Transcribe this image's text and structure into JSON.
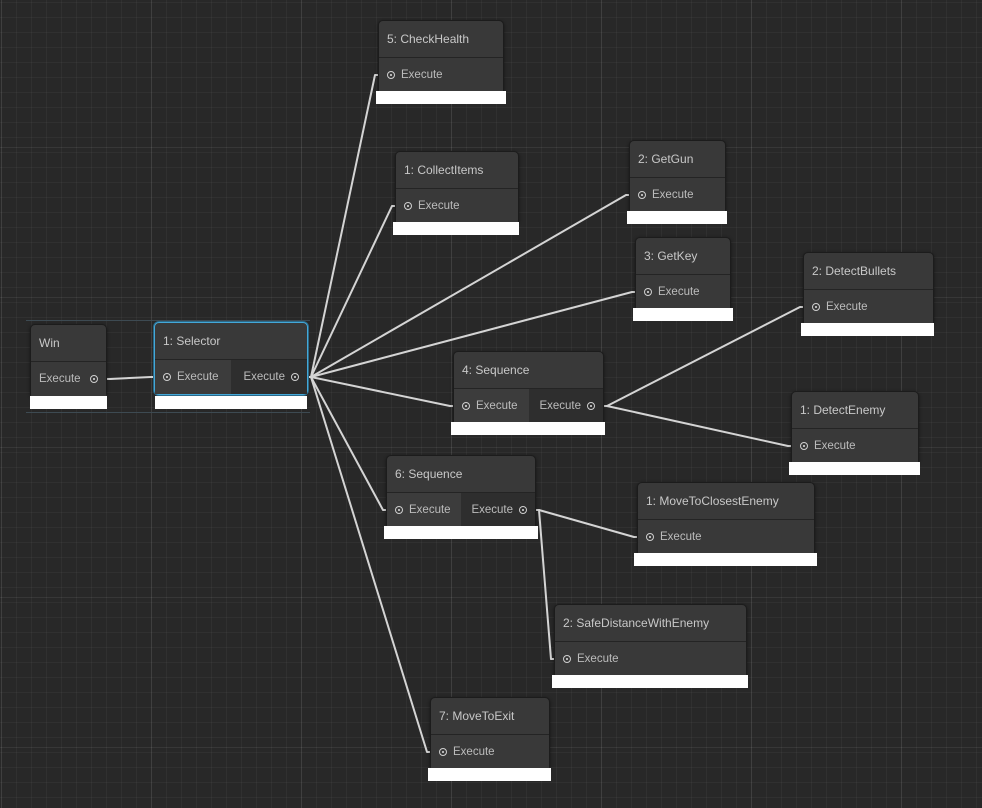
{
  "graph": {
    "accent_color": "#44a8d8",
    "edge_color": "#d4d4d4",
    "nodes": [
      {
        "id": "win",
        "title": "Win",
        "in_label": null,
        "out_label": "Execute"
      },
      {
        "id": "selector",
        "title": "1: Selector",
        "in_label": "Execute",
        "out_label": "Execute",
        "selected": true
      },
      {
        "id": "checkhealth",
        "title": "5: CheckHealth",
        "in_label": "Execute",
        "out_label": null
      },
      {
        "id": "collectitems",
        "title": "1: CollectItems",
        "in_label": "Execute",
        "out_label": null
      },
      {
        "id": "getgun",
        "title": "2: GetGun",
        "in_label": "Execute",
        "out_label": null
      },
      {
        "id": "getkey",
        "title": "3: GetKey",
        "in_label": "Execute",
        "out_label": null
      },
      {
        "id": "sequence4",
        "title": "4: Sequence",
        "in_label": "Execute",
        "out_label": "Execute"
      },
      {
        "id": "detectbullets",
        "title": "2: DetectBullets",
        "in_label": "Execute",
        "out_label": null
      },
      {
        "id": "detectenemy",
        "title": "1: DetectEnemy",
        "in_label": "Execute",
        "out_label": null
      },
      {
        "id": "sequence6",
        "title": "6: Sequence",
        "in_label": "Execute",
        "out_label": "Execute"
      },
      {
        "id": "movetoclosestenemy",
        "title": "1: MoveToClosestEnemy",
        "in_label": "Execute",
        "out_label": null
      },
      {
        "id": "safedistance",
        "title": "2: SafeDistanceWithEnemy",
        "in_label": "Execute",
        "out_label": null
      },
      {
        "id": "movetoexit",
        "title": "7: MoveToExit",
        "in_label": "Execute",
        "out_label": null
      }
    ],
    "edges": [
      {
        "from": "win",
        "to": "selector"
      },
      {
        "from": "selector",
        "to": "checkhealth"
      },
      {
        "from": "selector",
        "to": "collectitems"
      },
      {
        "from": "selector",
        "to": "getgun"
      },
      {
        "from": "selector",
        "to": "getkey"
      },
      {
        "from": "selector",
        "to": "sequence4"
      },
      {
        "from": "selector",
        "to": "sequence6"
      },
      {
        "from": "selector",
        "to": "movetoexit"
      },
      {
        "from": "sequence4",
        "to": "detectbullets"
      },
      {
        "from": "sequence4",
        "to": "detectenemy"
      },
      {
        "from": "sequence6",
        "to": "movetoclosestenemy"
      },
      {
        "from": "sequence6",
        "to": "safedistance"
      }
    ]
  }
}
